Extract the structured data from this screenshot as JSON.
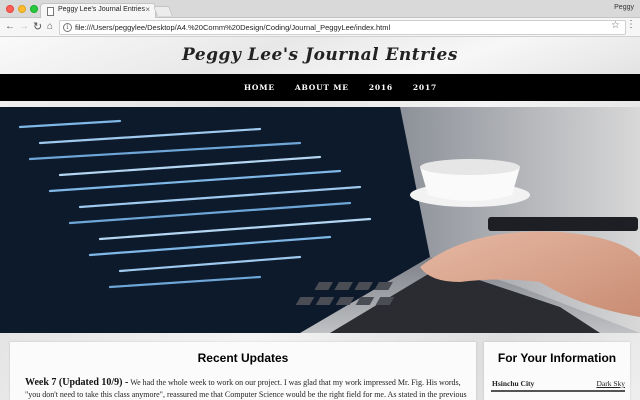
{
  "browser": {
    "tab_title": "Peggy Lee's Journal Entries",
    "tab_close": "×",
    "profile_name": "Peggy",
    "url": "file:///Users/peggylee/Desktop/A4.%20Comm%20Design/Coding/Journal_PeggyLee/index.html",
    "back": "←",
    "forward": "→",
    "reload": "↻",
    "home": "⌂",
    "info": "i",
    "star": "☆",
    "menu": "⋮"
  },
  "site": {
    "title": "Peggy Lee's Journal Entries"
  },
  "nav": {
    "items": [
      {
        "label": "Home"
      },
      {
        "label": "About Me"
      },
      {
        "label": "2016"
      },
      {
        "label": "2017"
      }
    ]
  },
  "main": {
    "heading": "Recent Updates",
    "entry_title": "Week 7 (Updated 10/9) -",
    "entry_text": "We had the whole week to work on our project. I was glad that my work impressed Mr. Fig. His words, \"you don't need to take this class anymore\", reassured me that Computer Science would be the right field for me. As stated in the previous entry, I like"
  },
  "sidebar": {
    "heading": "For Your Information",
    "city": "Hsinchu City",
    "weather_link": "Dark Sky"
  }
}
